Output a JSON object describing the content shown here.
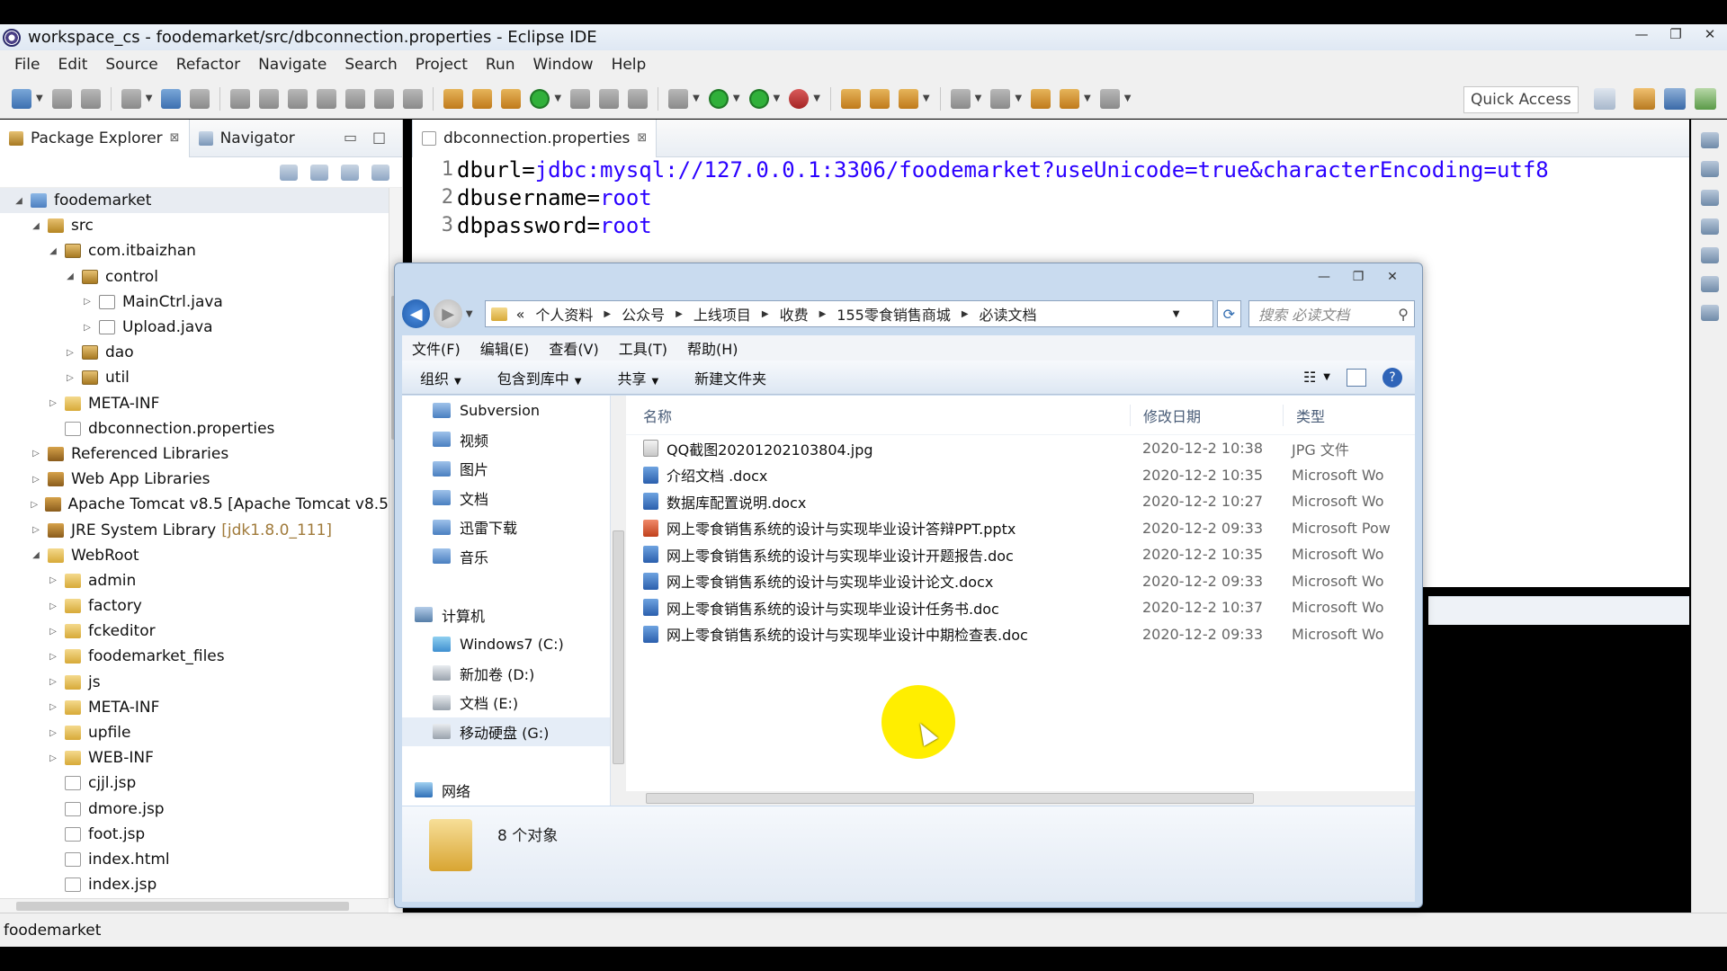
{
  "window": {
    "title": "workspace_cs - foodemarket/src/dbconnection.properties - Eclipse IDE",
    "controls": [
      "—",
      "❐",
      "✕"
    ]
  },
  "menu": [
    "File",
    "Edit",
    "Source",
    "Refactor",
    "Navigate",
    "Search",
    "Project",
    "Run",
    "Window",
    "Help"
  ],
  "toolbar": {
    "quick_access": "Quick Access"
  },
  "package_explorer": {
    "tabs": [
      {
        "label": "Package Explorer",
        "close": "⊠"
      },
      {
        "label": "Navigator"
      }
    ],
    "tree": [
      {
        "label": "foodemarket",
        "icon": "project-icon",
        "twisty": "◢",
        "depth": 0
      },
      {
        "label": "src",
        "icon": "source-folder-icon",
        "twisty": "◢",
        "depth": 1
      },
      {
        "label": "com.itbaizhan",
        "icon": "package-icon",
        "twisty": "◢",
        "depth": 2
      },
      {
        "label": "control",
        "icon": "package-icon",
        "twisty": "◢",
        "depth": 3
      },
      {
        "label": "MainCtrl.java",
        "icon": "java-file-icon",
        "twisty": "▷",
        "depth": 4
      },
      {
        "label": "Upload.java",
        "icon": "java-file-icon",
        "twisty": "▷",
        "depth": 4
      },
      {
        "label": "dao",
        "icon": "package-icon",
        "twisty": "▷",
        "depth": 3
      },
      {
        "label": "util",
        "icon": "package-icon",
        "twisty": "▷",
        "depth": 3
      },
      {
        "label": "META-INF",
        "icon": "folder-icon",
        "twisty": "▷",
        "depth": 2
      },
      {
        "label": "dbconnection.properties",
        "icon": "file-icon",
        "twisty": "",
        "depth": 2
      },
      {
        "label": "Referenced Libraries",
        "icon": "library-icon",
        "twisty": "▷",
        "depth": 1
      },
      {
        "label": "Web App Libraries",
        "icon": "library-icon",
        "twisty": "▷",
        "depth": 1
      },
      {
        "label": "Apache Tomcat v8.5 [Apache Tomcat v8.5",
        "icon": "library-icon",
        "twisty": "▷",
        "depth": 1
      },
      {
        "label": "JRE System Library",
        "suffix": "[jdk1.8.0_111]",
        "icon": "library-icon",
        "twisty": "▷",
        "depth": 1
      },
      {
        "label": "WebRoot",
        "icon": "folder-icon",
        "twisty": "◢",
        "depth": 1
      },
      {
        "label": "admin",
        "icon": "folder-icon",
        "twisty": "▷",
        "depth": 2
      },
      {
        "label": "factory",
        "icon": "folder-icon",
        "twisty": "▷",
        "depth": 2
      },
      {
        "label": "fckeditor",
        "icon": "folder-icon",
        "twisty": "▷",
        "depth": 2
      },
      {
        "label": "foodemarket_files",
        "icon": "folder-icon",
        "twisty": "▷",
        "depth": 2
      },
      {
        "label": "js",
        "icon": "folder-icon",
        "twisty": "▷",
        "depth": 2
      },
      {
        "label": "META-INF",
        "icon": "folder-icon",
        "twisty": "▷",
        "depth": 2
      },
      {
        "label": "upfile",
        "icon": "folder-icon",
        "twisty": "▷",
        "depth": 2
      },
      {
        "label": "WEB-INF",
        "icon": "folder-icon",
        "twisty": "▷",
        "depth": 2
      },
      {
        "label": "cjjl.jsp",
        "icon": "file-icon",
        "twisty": "",
        "depth": 2
      },
      {
        "label": "dmore.jsp",
        "icon": "file-icon",
        "twisty": "",
        "depth": 2
      },
      {
        "label": "foot.jsp",
        "icon": "file-icon",
        "twisty": "",
        "depth": 2
      },
      {
        "label": "index.html",
        "icon": "file-icon",
        "twisty": "",
        "depth": 2
      },
      {
        "label": "index.jsp",
        "icon": "file-icon",
        "twisty": "",
        "depth": 2
      }
    ]
  },
  "editor": {
    "tab": "dbconnection.properties",
    "tab_close": "⊠",
    "lines": [
      {
        "n": "1",
        "key": "dburl=",
        "value": "jdbc:mysql://127.0.0.1:3306/foodemarket?useUnicode=true&characterEncoding=utf8"
      },
      {
        "n": "2",
        "key": "dbusername=",
        "value": "root"
      },
      {
        "n": "3",
        "key": "dbpassword=",
        "value": "root"
      }
    ]
  },
  "status_bar": {
    "text": "foodemarket"
  },
  "explorer": {
    "controls": [
      "—",
      "❐",
      "✕"
    ],
    "breadcrumb": [
      "个人资料",
      "公众号",
      "上线项目",
      "收费",
      "155零食销售商城",
      "必读文档"
    ],
    "breadcrumb_prefix": "«",
    "search_placeholder": "搜索 必读文档",
    "menu": [
      "文件(F)",
      "编辑(E)",
      "查看(V)",
      "工具(T)",
      "帮助(H)"
    ],
    "commands": [
      {
        "label": "组织",
        "dropdown": true
      },
      {
        "label": "包含到库中",
        "dropdown": true
      },
      {
        "label": "共享",
        "dropdown": true
      },
      {
        "label": "新建文件夹",
        "dropdown": false
      }
    ],
    "nav": [
      {
        "label": "Subversion",
        "icon": "subversion-icon",
        "indent": 1
      },
      {
        "label": "视频",
        "icon": "video-icon",
        "indent": 1
      },
      {
        "label": "图片",
        "icon": "pictures-icon",
        "indent": 1
      },
      {
        "label": "文档",
        "icon": "documents-icon",
        "indent": 1
      },
      {
        "label": "迅雷下载",
        "icon": "download-icon",
        "indent": 1
      },
      {
        "label": "音乐",
        "icon": "music-icon",
        "indent": 1
      },
      {
        "label": "",
        "icon": "",
        "indent": 0
      },
      {
        "label": "计算机",
        "icon": "computer-icon",
        "indent": 0
      },
      {
        "label": "Windows7 (C:)",
        "icon": "windows-drive-icon",
        "indent": 1
      },
      {
        "label": "新加卷 (D:)",
        "icon": "drive-icon",
        "indent": 1
      },
      {
        "label": "文档 (E:)",
        "icon": "drive-icon",
        "indent": 1
      },
      {
        "label": "移动硬盘 (G:)",
        "icon": "drive-icon",
        "indent": 1,
        "selected": true
      },
      {
        "label": "",
        "icon": "",
        "indent": 0
      },
      {
        "label": "网络",
        "icon": "network-icon",
        "indent": 0
      }
    ],
    "columns": [
      "名称",
      "修改日期",
      "类型"
    ],
    "files": [
      {
        "name": "QQ截图20201202103804.jpg",
        "date": "2020-12-2 10:38",
        "type": "JPG 文件",
        "icon": "jpg"
      },
      {
        "name": "介绍文档 .docx",
        "date": "2020-12-2 10:35",
        "type": "Microsoft Wo",
        "icon": "doc"
      },
      {
        "name": "数据库配置说明.docx",
        "date": "2020-12-2 10:27",
        "type": "Microsoft Wo",
        "icon": "doc"
      },
      {
        "name": "网上零食销售系统的设计与实现毕业设计答辩PPT.pptx",
        "date": "2020-12-2 09:33",
        "type": "Microsoft Pow",
        "icon": "ppt"
      },
      {
        "name": "网上零食销售系统的设计与实现毕业设计开题报告.doc",
        "date": "2020-12-2 10:35",
        "type": "Microsoft Wo",
        "icon": "doc"
      },
      {
        "name": "网上零食销售系统的设计与实现毕业设计论文.docx",
        "date": "2020-12-2 09:33",
        "type": "Microsoft Wo",
        "icon": "doc"
      },
      {
        "name": "网上零食销售系统的设计与实现毕业设计任务书.doc",
        "date": "2020-12-2 10:37",
        "type": "Microsoft Wo",
        "icon": "doc"
      },
      {
        "name": "网上零食销售系统的设计与实现毕业设计中期检查表.doc",
        "date": "2020-12-2 09:33",
        "type": "Microsoft Wo",
        "icon": "doc"
      }
    ],
    "item_count": "8 个对象"
  },
  "colors": {
    "code_value": "#2a00ff",
    "cursor_highlight": "#ffee00",
    "explorer_frame": "#c9dbef"
  }
}
